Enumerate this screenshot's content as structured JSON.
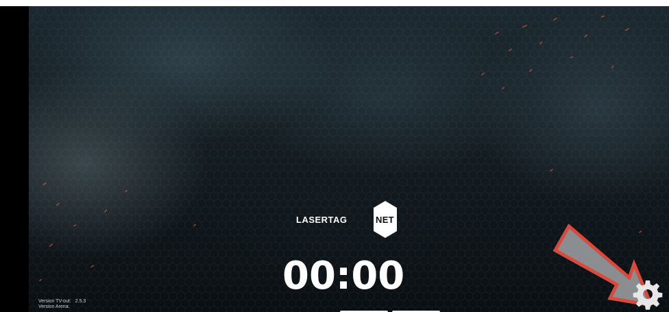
{
  "timer": {
    "value": "00:00"
  },
  "logo": {
    "part1": "LASERTAG",
    "part2": "NET"
  },
  "version": {
    "tvout_label": "Version TV-out:",
    "tvout_value": "2.5.3",
    "arena_label": "Version Arena:"
  },
  "icons": {
    "settings": "gear-icon",
    "annotation": "red-arrow-icon"
  },
  "colors": {
    "background": "#141d22",
    "text": "#ffffff",
    "arrow_fill": "#8a8e90",
    "arrow_stroke": "#d94a3d",
    "gear": "#e6e6e6"
  }
}
